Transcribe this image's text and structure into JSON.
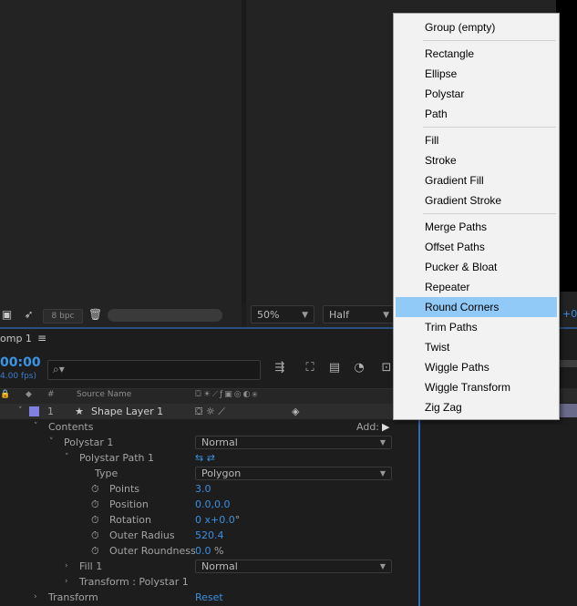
{
  "viewer": {
    "bpc_label": "8 bpc",
    "zoom_value": "50%",
    "resolution_value": "Half",
    "partial_text": "+0."
  },
  "timeline": {
    "tab_label": "omp 1",
    "menu_glyph": "≡",
    "timecode": "00:00",
    "fps": "4.00 fps)",
    "col_hash": "#",
    "col_source": "Source Name"
  },
  "layers": {
    "layer_index": "1",
    "layer_name": "Shape Layer 1",
    "contents_label": "Contents",
    "add_label": "Add:",
    "polystar_label": "Polystar 1",
    "polystar_mode": "Normal",
    "polystar_path_label": "Polystar Path 1",
    "type_label": "Type",
    "type_value": "Polygon",
    "points_label": "Points",
    "points_value": "3.0",
    "position_label": "Position",
    "position_value": "0.0,0.0",
    "rotation_label": "Rotation",
    "rotation_value": "0 x+0.0",
    "rotation_unit": "°",
    "outer_radius_label": "Outer Radius",
    "outer_radius_value": "520.4",
    "outer_roundness_label": "Outer Roundness",
    "outer_roundness_value": "0.0",
    "outer_roundness_unit": "%",
    "fill_label": "Fill 1",
    "fill_mode": "Normal",
    "transform_polystar_label": "Transform : Polystar 1",
    "transform_label": "Transform",
    "transform_value": "Reset"
  },
  "menu": {
    "items": [
      "Group (empty)",
      "Rectangle",
      "Ellipse",
      "Polystar",
      "Path",
      "Fill",
      "Stroke",
      "Gradient Fill",
      "Gradient Stroke",
      "Merge Paths",
      "Offset Paths",
      "Pucker & Bloat",
      "Repeater",
      "Round Corners",
      "Trim Paths",
      "Twist",
      "Wiggle Paths",
      "Wiggle Transform",
      "Zig Zag"
    ],
    "highlighted": "Round Corners"
  },
  "colors": {
    "accent": "#3a95e6",
    "menu_highlight": "#91c9f7",
    "label_swatch": "#8080e0"
  },
  "icons": [
    "snapshot-icon",
    "show-snapshot-icon",
    "trash-icon",
    "search-icon",
    "stopwatch-icon",
    "star-icon",
    "add-circle-icon",
    "chevron-down-icon",
    "twirl-icon"
  ]
}
